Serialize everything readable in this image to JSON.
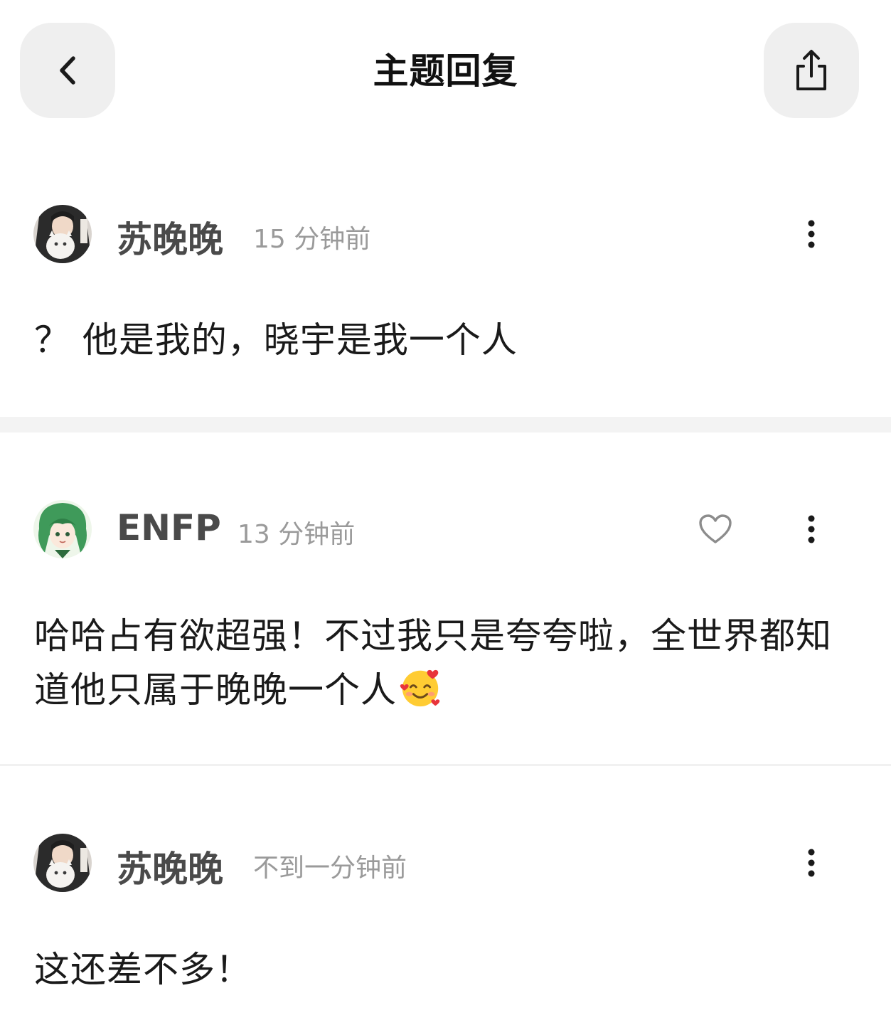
{
  "header": {
    "title": "主题回复",
    "back_icon": "chevron-left-icon",
    "share_icon": "share-icon"
  },
  "posts": [
    {
      "username": "苏晚晚",
      "time": "15 分钟前",
      "avatar": "avatar-cat-girl",
      "more_icon": "more-vertical-icon",
      "content": "？ 他是我的，晓宇是我一个人"
    },
    {
      "username": "ENFP",
      "time": "13 分钟前",
      "avatar": "avatar-green-hair-anime",
      "like_icon": "heart-outline-icon",
      "more_icon": "more-vertical-icon",
      "content_line1": "哈哈占有欲超强！不过我只是夸夸啦，全世界都知",
      "content_line2": "道他只属于晚晚一个人",
      "emoji": "smiling-face-with-hearts"
    },
    {
      "username": "苏晚晚",
      "time": "不到一分钟前",
      "avatar": "avatar-cat-girl",
      "more_icon": "more-vertical-icon",
      "content": "这还差不多！"
    }
  ],
  "colors": {
    "background": "#ffffff",
    "button_bg": "#efefef",
    "username": "#4a4a4a",
    "time": "#9a9a9a",
    "divider": "#f3f3f3"
  }
}
